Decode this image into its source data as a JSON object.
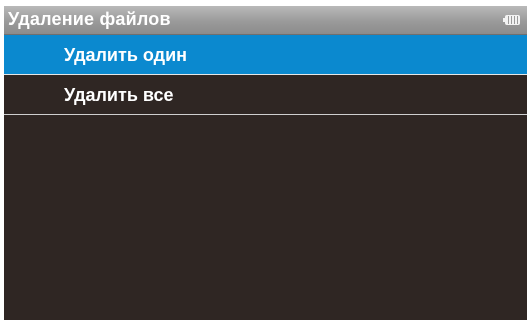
{
  "header": {
    "title": "Удаление файлов",
    "battery_icon": "battery-icon"
  },
  "menu": {
    "items": [
      {
        "label": "Удалить один",
        "selected": true
      },
      {
        "label": "Удалить все",
        "selected": false
      }
    ]
  },
  "colors": {
    "screen_background": "#2f2623",
    "selection": "#0b89cf",
    "title_bar": "#9a9a9a",
    "text": "#ffffff"
  }
}
